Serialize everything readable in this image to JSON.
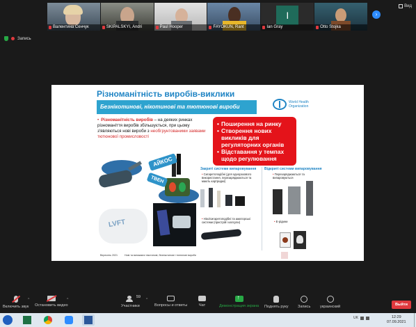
{
  "participants": [
    {
      "name": "Валентина Сенчук",
      "bg": "#4a5a6a"
    },
    {
      "name": "SKIPALSKYI, Andri",
      "bg": "#4d4f47"
    },
    {
      "name": "Paul Hooper",
      "bg": "#c9c9c9"
    },
    {
      "name": "FAYOKUN, Rant",
      "bg": "#5c6f84"
    },
    {
      "name": "Ian Gray",
      "bg": "#1f6b5a",
      "initial": "I"
    },
    {
      "name": "Otto Stojka",
      "bg": "#2a4b57"
    }
  ],
  "view_label": "Вид",
  "recording_label": "Запись",
  "slide": {
    "title": "Різноманітність виробів-виклики",
    "subtitle": "Безнікотинові, нікотинові та тютюнові вироби",
    "who_text": "World Health Organization",
    "bullet": {
      "lead": "Різноманітність виробів",
      "body": " – на деяких ринках різноманіття виробів збільшується, при цьому з'являються нові вироби з ",
      "emph": "необгрунтованими заявами тютюнової промисловості"
    },
    "red_items": [
      "Поширення на ринку",
      "Створення нових викликів для регуляторних органів",
      "Відставання у темпах щодо регулювання"
    ],
    "label_iqos": "АЙКОС",
    "label_tven": "ТВЕН",
    "box_text": "LVFT",
    "closed_title": "Закриті системи випаровування",
    "closed_items": [
      "Сигаретоподібні (для одноразового використання, перезаряджаються та мають картриджі)",
      "Ніко/сигаретоподібні та аматорські системи (пристрій і капсули)"
    ],
    "open_title": "Відкриті системи випаровування",
    "open_items": [
      "Перезаряджаються та випаровуються",
      "Е-рідини"
    ],
    "footnote_month": "Вересень 2021",
    "footnote_text": "Нові та виникаючі нікотинові, безнікотинові і тютюнові вироби"
  },
  "toolbar": {
    "mute": "Включить звук",
    "video": "Остановить видео",
    "participants": "Участники",
    "participants_count": "59",
    "qa": "Вопросы и ответы",
    "chat": "Чат",
    "share": "Демонстрация экрана",
    "raise": "Поднять руку",
    "record": "Запись",
    "lang": "украинский",
    "leave": "Выйти"
  },
  "taskbar": {
    "lang": "UK",
    "time": "12:29",
    "date": "07.09.2021"
  },
  "colors": {
    "accent_blue": "#1f84c4",
    "alert_red": "#e4131a",
    "share_green": "#27a845"
  }
}
